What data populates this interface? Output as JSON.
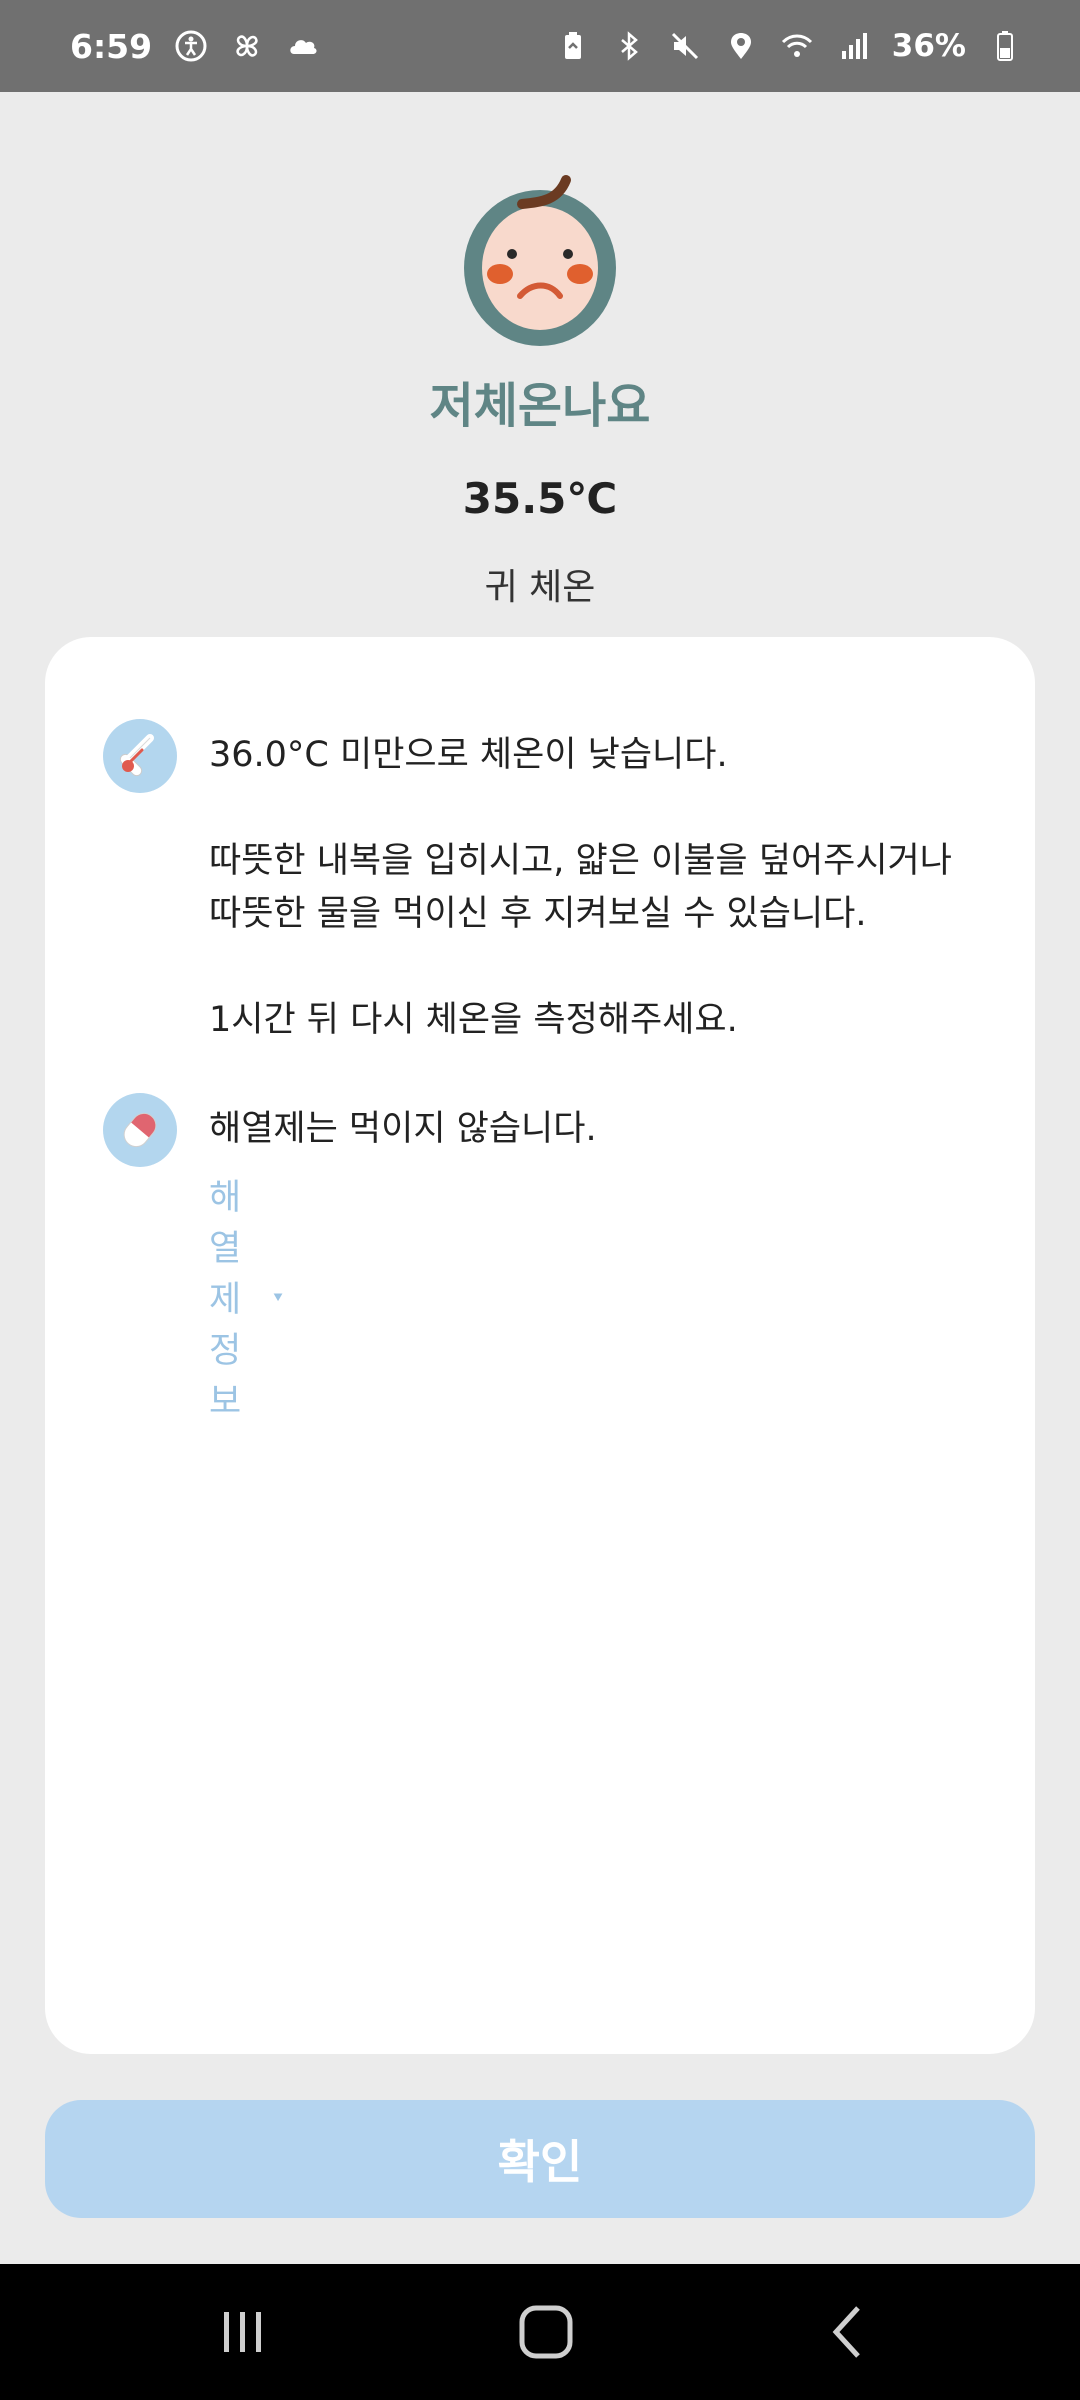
{
  "status_bar": {
    "time": "6:59",
    "battery_percent": "36%",
    "icons": [
      "accessibility-icon",
      "pinwheel-icon",
      "cloud-icon",
      "battery-saver-icon",
      "bluetooth-icon",
      "mute-icon",
      "location-icon",
      "wifi-icon",
      "signal-icon",
      "battery-icon"
    ]
  },
  "result": {
    "title": "저체온나요",
    "temperature": "35.5℃",
    "method": "귀 체온"
  },
  "card": {
    "row1": {
      "icon": "thermometer-icon",
      "lines": [
        "36.0°C 미만으로 체온이 낮습니다.",
        "따뜻한 내복을 입히시고, 얇은 이불을 덮어주시거나",
        "따뜻한 물을 먹이신 후 지켜보실 수 있습니다.",
        "1시간 뒤 다시 체온을 측정해주세요."
      ]
    },
    "row2": {
      "icon": "pill-icon",
      "text": "해열제는 먹이지 않습니다.",
      "link": "해열제 정보"
    }
  },
  "confirm_button": {
    "label": "확인"
  },
  "colors": {
    "accent_title": "#5f8585",
    "card_icon_bg": "#b3d6ee",
    "button_bg": "#b5d5f0",
    "link": "#9cc4e4"
  }
}
